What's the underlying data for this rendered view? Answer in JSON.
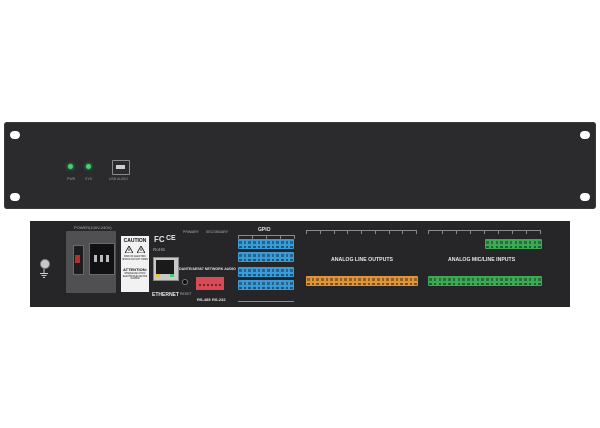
{
  "front_panel": {
    "led_labels": [
      "PWR",
      "SYS"
    ],
    "usb_label": "USB AUDIO"
  },
  "rear_panel": {
    "power_label": "POWER(100V-240V)",
    "caution": {
      "title": "CAUTION",
      "warning_text": "RISK OF ELECTRIC SHOCK DO NOT OPEN",
      "attention_title": "ATTENTION:",
      "attention_text": "RISQUE DE CHOC ELECTRIQUE NE PAS OUVRIR"
    },
    "cert_fc": "FC",
    "cert_ce": "CE",
    "cert_rohs": "RoHS",
    "ethernet_label": "ETHERNET",
    "primary_label": "PRIMARY",
    "secondary_label": "SECONDARY",
    "dante_label": "DANTE/AES67 NETWORK AUDIO",
    "reset_label": "RESET",
    "rs485_label": "RS-485",
    "rs232_label": "RS-232",
    "gpio_label": "GPIO",
    "analog_outputs_label": "ANALOG LINE OUTPUTS",
    "analog_inputs_label": "ANALOG MIC/LINE INPUTS"
  },
  "colors": {
    "chassis": "#2b2b2d",
    "rear_chassis": "#262628",
    "gpio_blue": "#3a9bd8",
    "output_orange": "#e0943a",
    "input_green": "#3caa55",
    "serial_red": "#d84a56",
    "led_green": "#3fd36a"
  }
}
